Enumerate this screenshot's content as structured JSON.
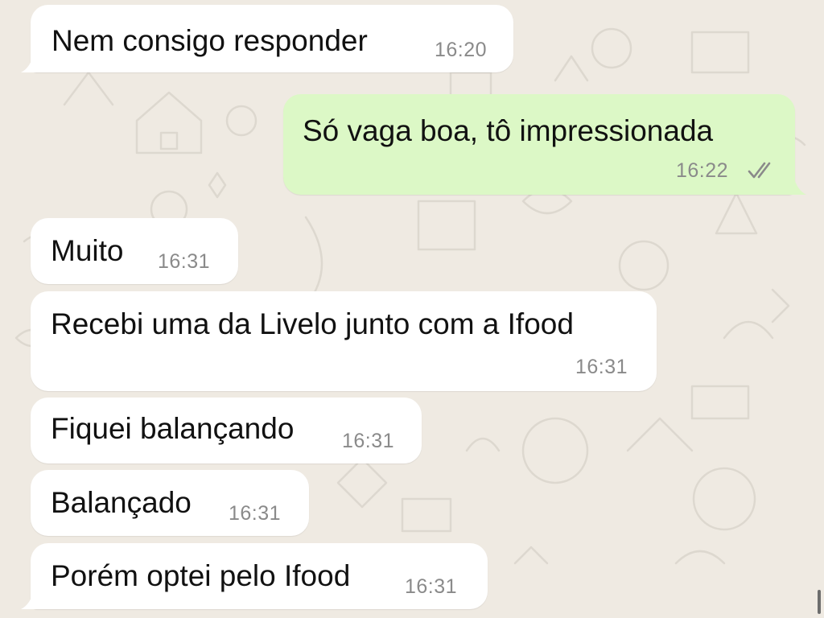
{
  "chat": {
    "messages": [
      {
        "direction": "in",
        "text": "Nem consigo responder",
        "time": "16:20"
      },
      {
        "direction": "out",
        "text": "Só vaga boa, tô impressionada",
        "time": "16:22",
        "status": "read-ticks-icon"
      },
      {
        "direction": "in",
        "text": "Muito",
        "time": "16:31"
      },
      {
        "direction": "in",
        "text": "Recebi uma da Livelo junto com a Ifood",
        "time": "16:31"
      },
      {
        "direction": "in",
        "text": "Fiquei balançando",
        "time": "16:31"
      },
      {
        "direction": "in",
        "text": "Balançado",
        "time": "16:31"
      },
      {
        "direction": "in",
        "text": "Porém optei pelo Ifood",
        "time": "16:31"
      }
    ]
  },
  "colors": {
    "background": "#efeae2",
    "incoming_bubble": "#ffffff",
    "outgoing_bubble": "#dcf8c6",
    "timestamp": "#8a8a8a",
    "ticks": "#8a8a8a"
  }
}
